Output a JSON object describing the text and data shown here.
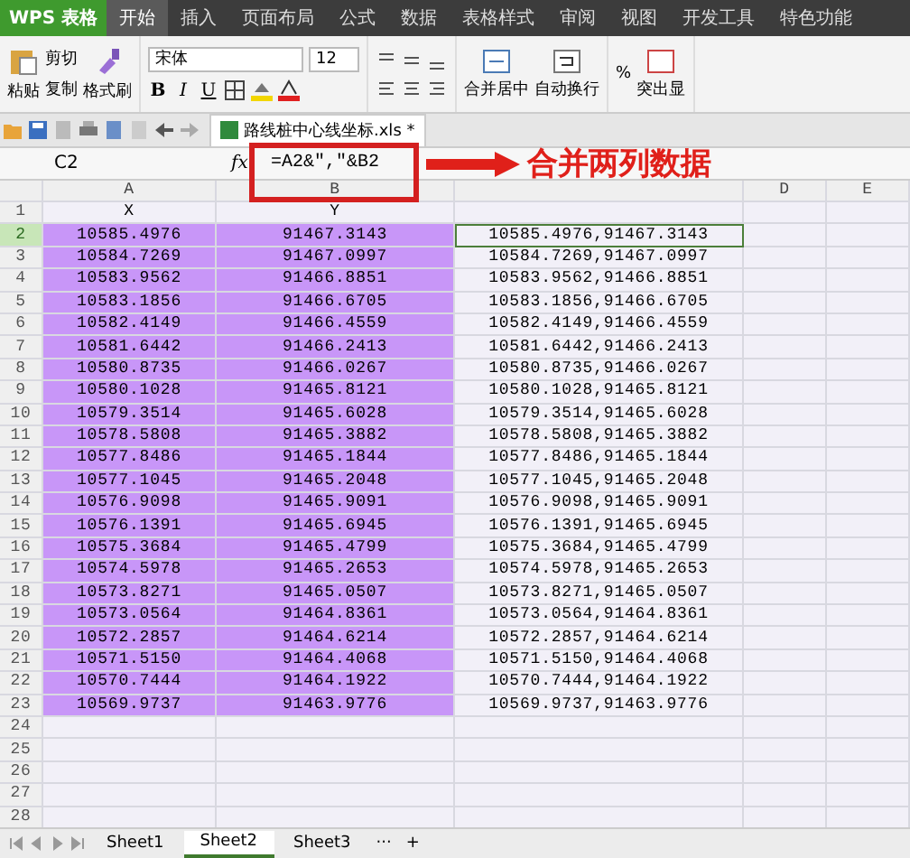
{
  "app_button": "WPS 表格",
  "menu_tabs": [
    {
      "label": "开始",
      "selected": true
    },
    {
      "label": "插入",
      "selected": false
    },
    {
      "label": "页面布局",
      "selected": false
    },
    {
      "label": "公式",
      "selected": false
    },
    {
      "label": "数据",
      "selected": false
    },
    {
      "label": "表格样式",
      "selected": false
    },
    {
      "label": "审阅",
      "selected": false
    },
    {
      "label": "视图",
      "selected": false
    },
    {
      "label": "开发工具",
      "selected": false
    },
    {
      "label": "特色功能",
      "selected": false
    }
  ],
  "ribbon": {
    "paste": "粘贴",
    "cut": "剪切",
    "copy": "复制",
    "format_painter": "格式刷",
    "font": "宋体",
    "font_size": "12",
    "bold": "B",
    "italic": "I",
    "underline": "U",
    "merge": "合并居中",
    "wrap": "自动换行",
    "percent": "%",
    "highlight": "突出显"
  },
  "document_tab": "路线桩中心线坐标.xls *",
  "formula_bar": {
    "name_box": "C2",
    "fx": "fx",
    "formula": "=A2&\",\"&B2"
  },
  "annotation": "合并两列数据",
  "columns": [
    {
      "kind": "label",
      "label": "A"
    },
    {
      "kind": "label",
      "label": "B"
    },
    {
      "kind": "covered"
    },
    {
      "kind": "label",
      "label": "D"
    },
    {
      "kind": "label",
      "label": "E"
    }
  ],
  "header_row": {
    "num": "1",
    "a": "X",
    "b": "Y"
  },
  "rows": [
    {
      "num": "2",
      "a": "10585.4976",
      "b": "91467.3143",
      "c": "10585.4976,91467.3143",
      "selected": true
    },
    {
      "num": "3",
      "a": "10584.7269",
      "b": "91467.0997",
      "c": "10584.7269,91467.0997",
      "selected": false
    },
    {
      "num": "4",
      "a": "10583.9562",
      "b": "91466.8851",
      "c": "10583.9562,91466.8851",
      "selected": false
    },
    {
      "num": "5",
      "a": "10583.1856",
      "b": "91466.6705",
      "c": "10583.1856,91466.6705",
      "selected": false
    },
    {
      "num": "6",
      "a": "10582.4149",
      "b": "91466.4559",
      "c": "10582.4149,91466.4559",
      "selected": false
    },
    {
      "num": "7",
      "a": "10581.6442",
      "b": "91466.2413",
      "c": "10581.6442,91466.2413",
      "selected": false
    },
    {
      "num": "8",
      "a": "10580.8735",
      "b": "91466.0267",
      "c": "10580.8735,91466.0267",
      "selected": false
    },
    {
      "num": "9",
      "a": "10580.1028",
      "b": "91465.8121",
      "c": "10580.1028,91465.8121",
      "selected": false
    },
    {
      "num": "10",
      "a": "10579.3514",
      "b": "91465.6028",
      "c": "10579.3514,91465.6028",
      "selected": false
    },
    {
      "num": "11",
      "a": "10578.5808",
      "b": "91465.3882",
      "c": "10578.5808,91465.3882",
      "selected": false
    },
    {
      "num": "12",
      "a": "10577.8486",
      "b": "91465.1844",
      "c": "10577.8486,91465.1844",
      "selected": false
    },
    {
      "num": "13",
      "a": "10577.1045",
      "b": "91465.2048",
      "c": "10577.1045,91465.2048",
      "selected": false
    },
    {
      "num": "14",
      "a": "10576.9098",
      "b": "91465.9091",
      "c": "10576.9098,91465.9091",
      "selected": false
    },
    {
      "num": "15",
      "a": "10576.1391",
      "b": "91465.6945",
      "c": "10576.1391,91465.6945",
      "selected": false
    },
    {
      "num": "16",
      "a": "10575.3684",
      "b": "91465.4799",
      "c": "10575.3684,91465.4799",
      "selected": false
    },
    {
      "num": "17",
      "a": "10574.5978",
      "b": "91465.2653",
      "c": "10574.5978,91465.2653",
      "selected": false
    },
    {
      "num": "18",
      "a": "10573.8271",
      "b": "91465.0507",
      "c": "10573.8271,91465.0507",
      "selected": false
    },
    {
      "num": "19",
      "a": "10573.0564",
      "b": "91464.8361",
      "c": "10573.0564,91464.8361",
      "selected": false
    },
    {
      "num": "20",
      "a": "10572.2857",
      "b": "91464.6214",
      "c": "10572.2857,91464.6214",
      "selected": false
    },
    {
      "num": "21",
      "a": "10571.5150",
      "b": "91464.4068",
      "c": "10571.5150,91464.4068",
      "selected": false
    },
    {
      "num": "22",
      "a": "10570.7444",
      "b": "91464.1922",
      "c": "10570.7444,91464.1922",
      "selected": false
    },
    {
      "num": "23",
      "a": "10569.9737",
      "b": "91463.9776",
      "c": "10569.9737,91463.9776",
      "selected": false
    }
  ],
  "empty_rows": [
    "24",
    "25",
    "26",
    "27",
    "28"
  ],
  "sheets": [
    {
      "label": "Sheet1",
      "selected": false
    },
    {
      "label": "Sheet2",
      "selected": true
    },
    {
      "label": "Sheet3",
      "selected": false
    }
  ],
  "sheet_more": "···",
  "sheet_add": "+"
}
